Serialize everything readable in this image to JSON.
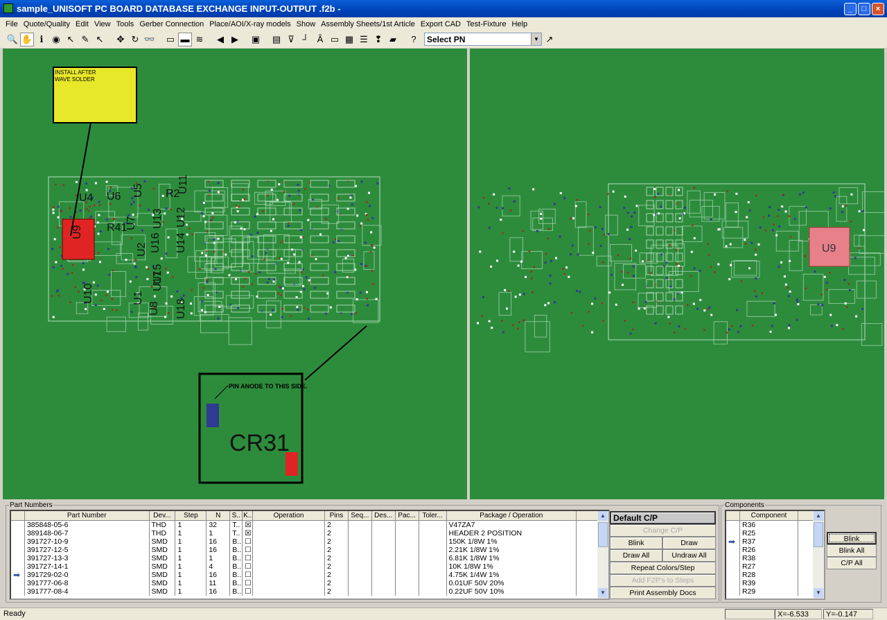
{
  "window": {
    "title": "sample_UNISOFT PC BOARD DATABASE EXCHANGE INPUT-OUTPUT .f2b -",
    "minimize": "_",
    "maximize": "□",
    "close": "×"
  },
  "menu": [
    "File",
    "Quote/Quality",
    "Edit",
    "View",
    "Tools",
    "Gerber Connection",
    "Place/AOI/X-ray models",
    "Show",
    "Assembly Sheets/1st Article",
    "Export CAD",
    "Test-Fixture",
    "Help"
  ],
  "toolbar": {
    "icons": [
      {
        "name": "zoom-icon",
        "glyph": "🔍"
      },
      {
        "name": "pan-hand-icon",
        "glyph": "✋",
        "active": true
      },
      {
        "name": "info-icon",
        "glyph": "ℹ"
      },
      {
        "name": "target-icon",
        "glyph": "◉"
      },
      {
        "name": "select-arrow-icon",
        "glyph": "↖"
      },
      {
        "name": "edit-icon",
        "glyph": "✎"
      },
      {
        "name": "pointer-query-icon",
        "glyph": "↖"
      },
      {
        "sep": true
      },
      {
        "name": "move-icon",
        "glyph": "✥"
      },
      {
        "name": "rotate-icon",
        "glyph": "↻"
      },
      {
        "name": "binoculars-icon",
        "glyph": "👓"
      },
      {
        "sep": true
      },
      {
        "name": "layer-top-icon",
        "glyph": "▭"
      },
      {
        "name": "layer-bottom-icon",
        "glyph": "▬",
        "active": true
      },
      {
        "name": "layer-both-icon",
        "glyph": "≋"
      },
      {
        "sep": true
      },
      {
        "name": "prev-icon",
        "glyph": "◀"
      },
      {
        "name": "next-icon",
        "glyph": "▶"
      },
      {
        "sep": true
      },
      {
        "name": "flip-icon",
        "glyph": "▣"
      },
      {
        "sep": true
      },
      {
        "name": "label-icon",
        "glyph": "▤"
      },
      {
        "name": "pins-icon",
        "glyph": "⊽"
      },
      {
        "name": "trace-icon",
        "glyph": "┘"
      },
      {
        "name": "pad-icon",
        "glyph": "Â"
      },
      {
        "name": "part-icon",
        "glyph": "▭"
      },
      {
        "name": "keyboard-icon",
        "glyph": "▦"
      },
      {
        "name": "steps-icon",
        "glyph": "☰"
      },
      {
        "name": "probe-icon",
        "glyph": "❢"
      },
      {
        "name": "note-icon",
        "glyph": "▰"
      },
      {
        "sep": true
      },
      {
        "name": "help-pointer-icon",
        "glyph": "?"
      }
    ],
    "select_pn": "Select PN",
    "pick_icon": "↗"
  },
  "board_left": {
    "labels": [
      "U4",
      "U6",
      "U5",
      "R2",
      "U11",
      "U9",
      "R41",
      "U7",
      "U13",
      "U12",
      "U16",
      "U14",
      "U2",
      "U15",
      "U10",
      "U1",
      "U8",
      "U17",
      "U18"
    ],
    "note1": [
      "INSTALL AFTER",
      "WAVE SOLDER"
    ],
    "note2": "PIN  ANODE TO THIS SIDE.",
    "note2_part": "CR31",
    "colors": {
      "board": "#2d8c3c",
      "highlight": "#e02424",
      "note": "#e8e82a"
    }
  },
  "board_right": {
    "highlight_label": "U9",
    "highlight_color": "#e8808a"
  },
  "part_numbers": {
    "legend": "Part Numbers",
    "columns": [
      "Part Number",
      "Dev...",
      "Step",
      "N",
      "S..",
      "K..",
      "Operation",
      "Pins",
      "Seq...",
      "Des...",
      "Pac...",
      "Toler...",
      "Package / Operation",
      ""
    ],
    "rows": [
      [
        "385848-05-6",
        "THD",
        "1",
        "32",
        "T..",
        true,
        "",
        "2",
        "",
        "",
        "",
        "",
        "V47ZA7"
      ],
      [
        "389148-06-7",
        "THD",
        "1",
        "1",
        "T..",
        true,
        "",
        "2",
        "",
        "",
        "",
        "",
        "HEADER 2 POSITION"
      ],
      [
        "391727-10-9",
        "SMD",
        "1",
        "16",
        "B..",
        false,
        "",
        "2",
        "",
        "",
        "",
        "",
        "150K 1/8W 1%"
      ],
      [
        "391727-12-5",
        "SMD",
        "1",
        "16",
        "B..",
        false,
        "",
        "2",
        "",
        "",
        "",
        "",
        "2.21K 1/8W 1%"
      ],
      [
        "391727-13-3",
        "SMD",
        "1",
        "1",
        "B..",
        false,
        "",
        "2",
        "",
        "",
        "",
        "",
        "6.81K 1/8W 1%"
      ],
      [
        "391727-14-1",
        "SMD",
        "1",
        "4",
        "B..",
        false,
        "",
        "2",
        "",
        "",
        "",
        "",
        "10K 1/8W 1%"
      ],
      [
        "391729-02-0",
        "SMD",
        "1",
        "16",
        "B..",
        false,
        "",
        "2",
        "",
        "",
        "",
        "",
        "4.75K 1/4W 1%"
      ],
      [
        "391777-06-8",
        "SMD",
        "1",
        "11",
        "B..",
        false,
        "",
        "2",
        "",
        "",
        "",
        "",
        "0.01UF 50V 20%"
      ],
      [
        "391777-08-4",
        "SMD",
        "1",
        "16",
        "B..",
        false,
        "",
        "2",
        "",
        "",
        "",
        "",
        "0.22UF 50V 10%"
      ]
    ],
    "current_row": 6
  },
  "cp": {
    "title": "Default C/P",
    "change": "Change C/P",
    "blink": "Blink",
    "draw": "Draw",
    "draw_all": "Draw All",
    "undraw_all": "Undraw All",
    "repeat": "Repeat Colors/Step",
    "add_f2p": "Add F2P's to Steps",
    "print": "Print Assembly Docs"
  },
  "components": {
    "legend": "Components",
    "column": "Component",
    "rows": [
      "R36",
      "R25",
      "R37",
      "R26",
      "R38",
      "R27",
      "R28",
      "R39",
      "R29"
    ],
    "current_row": 2,
    "blink": "Blink",
    "blink_all": "Blink All",
    "cp_all": "C/P All"
  },
  "status": {
    "text": "Ready",
    "x": "X=-6.533",
    "y": "Y=-0.147"
  }
}
